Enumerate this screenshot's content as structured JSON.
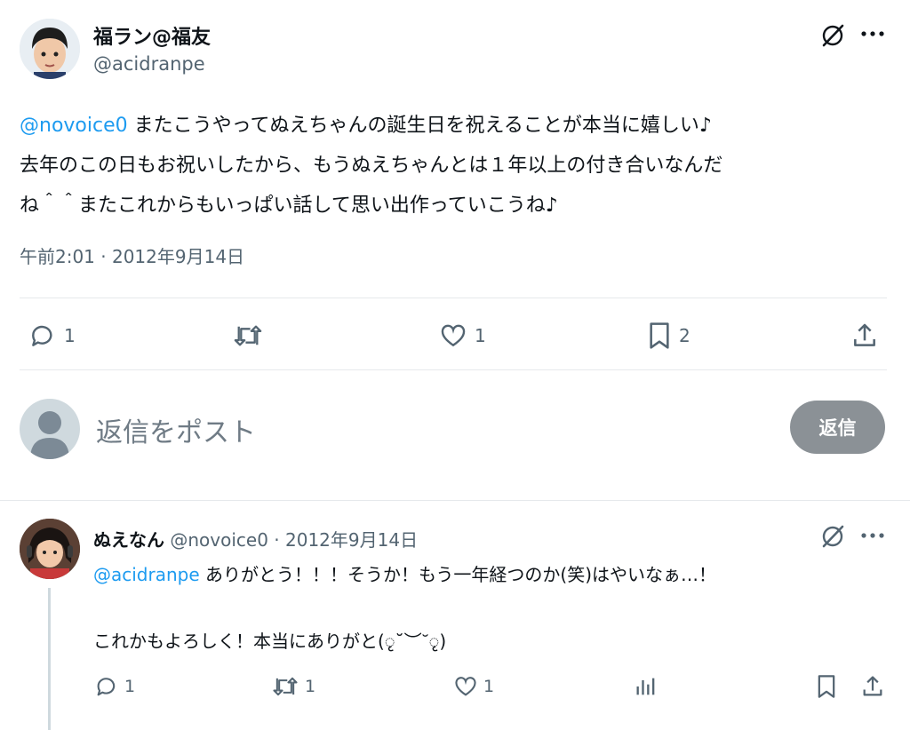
{
  "main_post": {
    "author_name": "福ラン@福友",
    "author_handle": "@acidranpe",
    "mention": "@novoice0",
    "text_line1": " またこうやってぬえちゃんの誕生日を祝えることが本当に嬉しい♪",
    "text_line2": "去年のこの日もお祝いしたから、もうぬえちゃんとは１年以上の付き合いなんだ",
    "text_line3": "ね＾＾またこれからもいっぱい話して思い出作っていこうね♪",
    "timestamp": "午前2:01 · 2012年9月14日",
    "stats": {
      "replies": "1",
      "likes": "1",
      "bookmarks": "2"
    }
  },
  "reply_composer": {
    "placeholder": "返信をポスト",
    "button_label": "返信"
  },
  "reply_post": {
    "author_name": "ぬえなん",
    "author_handle": "@novoice0",
    "date": "· 2012年9月14日",
    "mention": "@acidranpe",
    "text_line1": " ありがとう！！！そうか！もう一年経つのか(笑)はやいなぁ…！",
    "text_line2": "これかもよろしく！本当にありがと(ृ˘︶˘ृ)",
    "stats": {
      "replies": "1",
      "reposts": "1",
      "likes": "1"
    }
  },
  "colors": {
    "link": "#1d9bf0",
    "muted": "#536471",
    "button": "#8b9196"
  }
}
